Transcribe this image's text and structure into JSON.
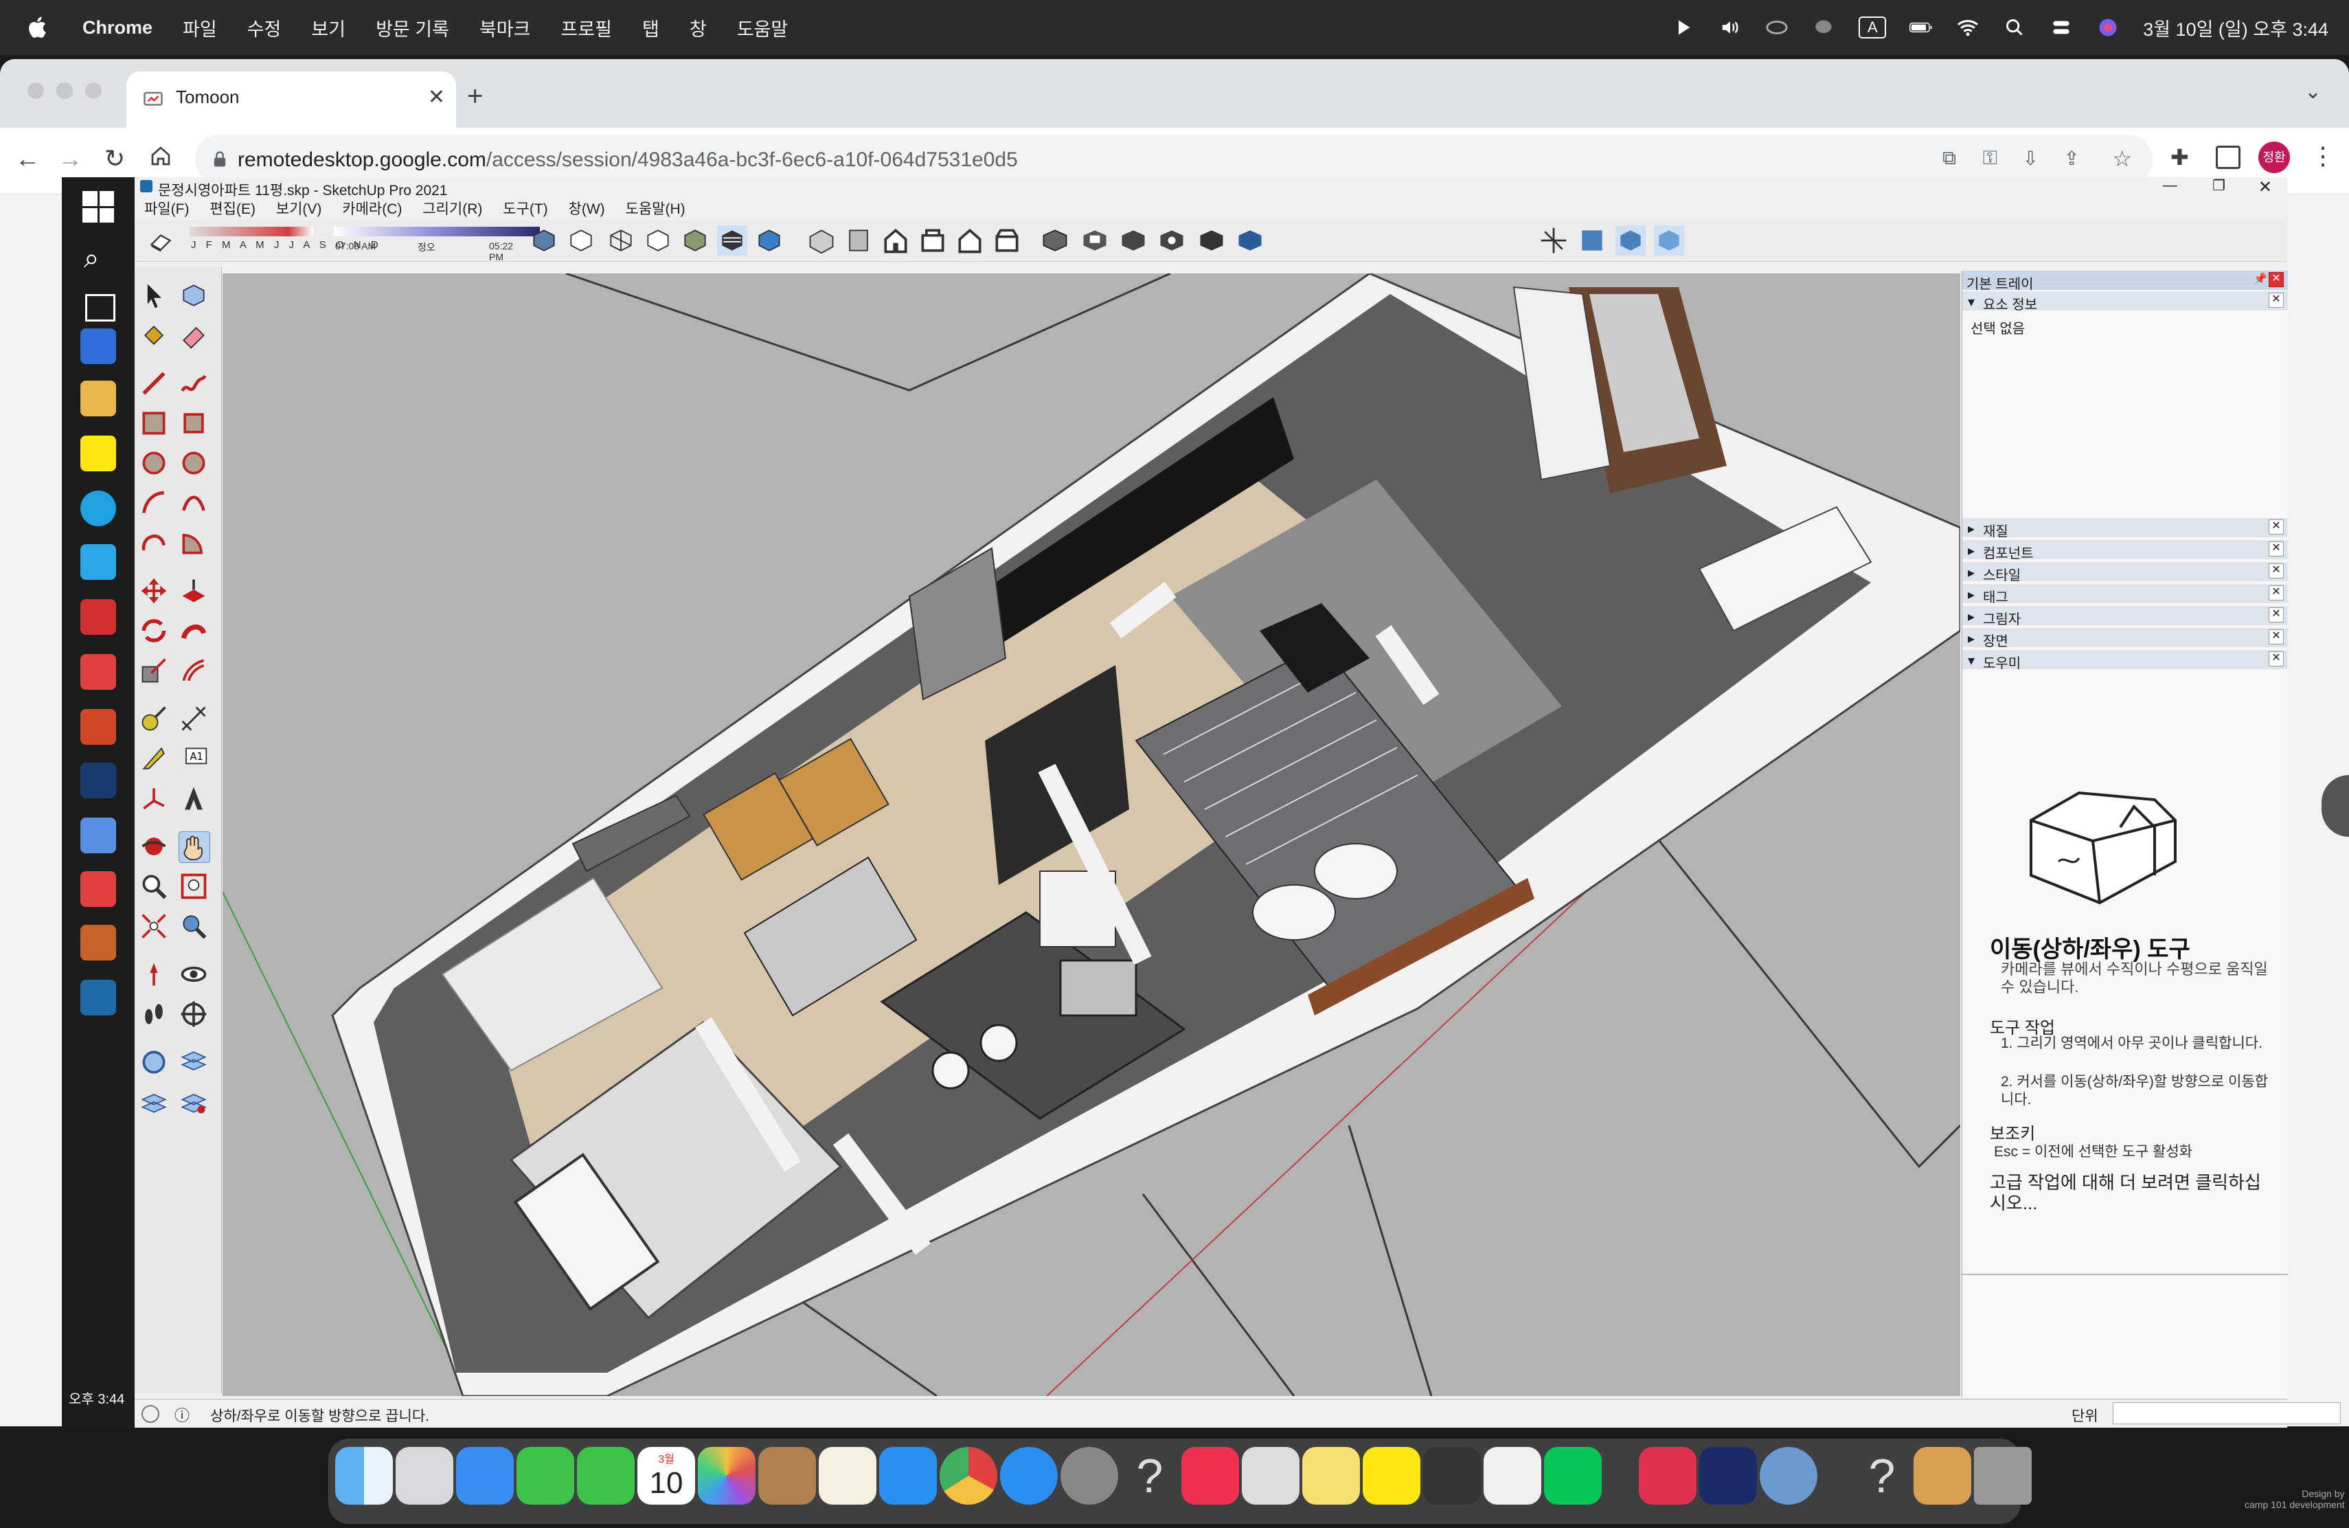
{
  "menubar": {
    "app": "Chrome",
    "items": [
      "파일",
      "수정",
      "보기",
      "방문 기록",
      "북마크",
      "프로필",
      "탭",
      "창",
      "도움말"
    ],
    "clock": "3월 10일 (일) 오후 3:44",
    "input_indicator": "A"
  },
  "browser": {
    "tab_title": "Tomoon",
    "url_host": "remotedesktop.google.com",
    "url_path": "/access/session/4983a46a-bc3f-6ec6-a10f-064d7531e0d5",
    "profile_initials": "정환"
  },
  "windows": {
    "taskbar_time": "오후 3:44"
  },
  "sketchup": {
    "title": "문정시영아파트 11평.skp - SketchUp Pro 2021",
    "menu": [
      "파일(F)",
      "편집(E)",
      "보기(V)",
      "카메라(C)",
      "그리기(R)",
      "도구(T)",
      "창(W)",
      "도움말(H)"
    ],
    "shadow": {
      "months": "J F M A M J J A S O N D",
      "time_start": "07:08 AM",
      "time_mid": "정오",
      "time_end": "05:22 PM"
    },
    "status_text": "상하/좌우로 이동할 방향으로 끕니다.",
    "units_label": "단위"
  },
  "tray": {
    "title": "기본 트레이",
    "entity_info": "요소 정보",
    "no_selection": "선택 없음",
    "panels": [
      "재질",
      "컴포넌트",
      "스타일",
      "태그",
      "그림자",
      "장면",
      "도우미"
    ],
    "instructor": {
      "heading": "이동(상하/좌우) 도구",
      "desc": "카메라를 뷰에서 수직이나 수평으로 움직일 수 있습니다.",
      "ops_title": "도구 작업",
      "op1": "1. 그리기 영역에서 아무 곳이나 클릭합니다.",
      "op2": "2. 커서를 이동(상하/좌우)할 방향으로 이동합니다.",
      "mod_title": "보조키",
      "mod1": "Esc = 이전에 선택한 도구 활성화",
      "advanced": "고급 작업에 대해 더 보려면 클릭하십시오..."
    }
  },
  "dock": {
    "calendar_month": "3월",
    "calendar_day": "10",
    "watermark": "Design by\ncamp 101 development"
  },
  "colors": {
    "menubar": "#2b2b2e",
    "viewport_bg": "#b3b3b3",
    "wall_dark": "#6b6b6b",
    "floor_wood": "#d8ccb4"
  }
}
